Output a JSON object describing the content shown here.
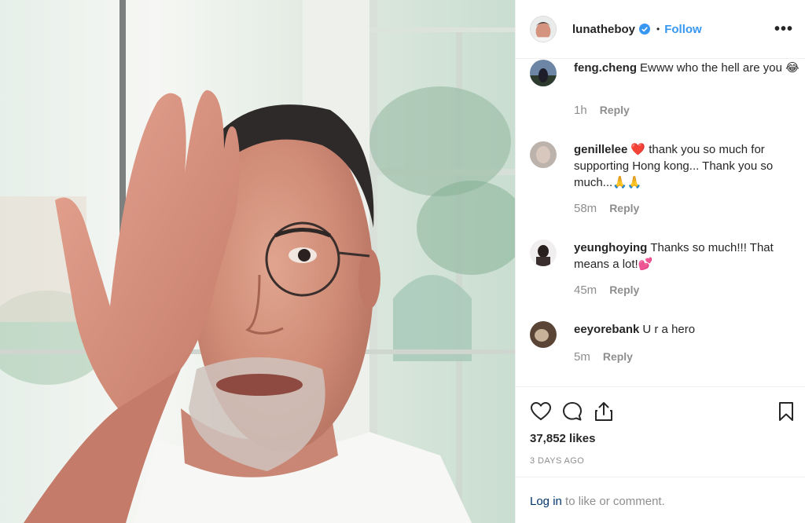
{
  "post": {
    "username": "lunatheboy",
    "follow_label": "Follow",
    "separator": "•",
    "more_label": "•••",
    "likes": "37,852 likes",
    "timestamp": "3 DAYS AGO"
  },
  "comments": [
    {
      "user": "feng.cheng",
      "text": "Ewww who the hell are you 😂",
      "time": "1h",
      "reply": "Reply"
    },
    {
      "user": "genillelee",
      "text": "❤️ thank you so much for supporting Hong kong... Thank you so much...🙏🙏",
      "time": "58m",
      "reply": "Reply"
    },
    {
      "user": "yeunghoying",
      "text": "Thanks so much!!! That means a lot!💕",
      "time": "45m",
      "reply": "Reply"
    },
    {
      "user": "eeyorebank",
      "text": "U r a hero",
      "time": "5m",
      "reply": "Reply"
    }
  ],
  "login": {
    "link": "Log in",
    "suffix": " to like or comment."
  },
  "icons": {
    "verified": "verified-badge-icon",
    "like": "heart-icon",
    "comment": "comment-bubble-icon",
    "share": "share-icon",
    "save": "bookmark-icon",
    "more": "more-options-icon"
  },
  "colors": {
    "accent": "#3897f0",
    "text": "#262626",
    "muted": "#8e8e8e",
    "link": "#003569"
  }
}
